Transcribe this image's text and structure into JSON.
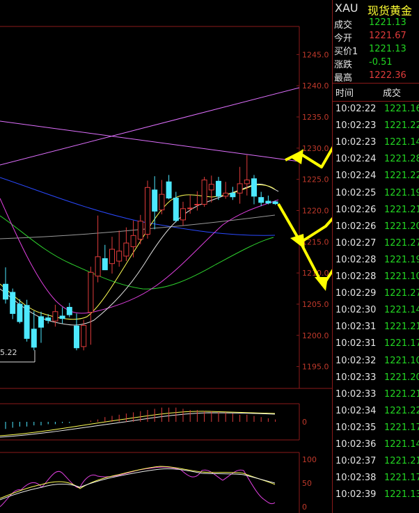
{
  "header": {
    "symbol": "XAU",
    "name": "现货黄金"
  },
  "quote": [
    {
      "label": "成交",
      "value": "1221.13",
      "color": "#22d622"
    },
    {
      "label": "今开",
      "value": "1221.67",
      "color": "#e03b3b"
    },
    {
      "label": "买价1",
      "value": "1221.13",
      "color": "#22d622"
    },
    {
      "label": "涨跌",
      "value": "-0.51",
      "color": "#22d622"
    },
    {
      "label": "最高",
      "value": "1222.36",
      "color": "#e03b3b"
    }
  ],
  "ticks_header": {
    "time": "时间",
    "price": "成交"
  },
  "ticks": [
    {
      "time": "10:02:22",
      "price": "1221.16"
    },
    {
      "time": "10:02:23",
      "price": "1221.22"
    },
    {
      "time": "10:02:23",
      "price": "1221.14"
    },
    {
      "time": "10:02:24",
      "price": "1221.28"
    },
    {
      "time": "10:02:24",
      "price": "1221.22"
    },
    {
      "time": "10:02:25",
      "price": "1221.19"
    },
    {
      "time": "10:02:26",
      "price": "1221.21"
    },
    {
      "time": "10:02:26",
      "price": "1221.20"
    },
    {
      "time": "10:02:27",
      "price": "1221.27"
    },
    {
      "time": "10:02:28",
      "price": "1221.19"
    },
    {
      "time": "10:02:28",
      "price": "1221.10"
    },
    {
      "time": "10:02:29",
      "price": "1221.27"
    },
    {
      "time": "10:02:30",
      "price": "1221.14"
    },
    {
      "time": "10:02:31",
      "price": "1221.21"
    },
    {
      "time": "10:02:31",
      "price": "1221.17"
    },
    {
      "time": "10:02:32",
      "price": "1221.10"
    },
    {
      "time": "10:02:33",
      "price": "1221.20"
    },
    {
      "time": "10:02:33",
      "price": "1221.21"
    },
    {
      "time": "10:02:34",
      "price": "1221.22"
    },
    {
      "time": "10:02:35",
      "price": "1221.17"
    },
    {
      "time": "10:02:36",
      "price": "1221.14"
    },
    {
      "time": "10:02:37",
      "price": "1221.21"
    },
    {
      "time": "10:02:38",
      "price": "1221.17"
    },
    {
      "time": "10:02:39",
      "price": "1221.13"
    }
  ],
  "main_axis_labels": [
    "1245.0",
    "1240.0",
    "1235.0",
    "1230.0",
    "1225.0",
    "1220.0",
    "1215.0",
    "1210.0",
    "1205.0",
    "1200.0",
    "1195.0"
  ],
  "low_marker_label": "5.22",
  "macd_axis_label": "0",
  "kdj_axis_labels": [
    "100",
    "50",
    "0"
  ],
  "colors": {
    "up": "#e03b3b",
    "down": "#4de8ff",
    "grid": "#8b1a1a",
    "arrow": "#ffff00"
  },
  "chart_data": {
    "type": "candlestick",
    "y_axis_ticks": [
      1245,
      1240,
      1235,
      1230,
      1225,
      1220,
      1215,
      1210,
      1205,
      1200,
      1195
    ],
    "ylim": [
      1191.5,
      1249.5
    ],
    "candles": [
      {
        "o": 1208.2,
        "h": 1210.9,
        "l": 1205.1,
        "c": 1205.8
      },
      {
        "o": 1206.9,
        "h": 1207.5,
        "l": 1202.6,
        "c": 1203.5
      },
      {
        "o": 1205.0,
        "h": 1205.8,
        "l": 1201.9,
        "c": 1202.2
      },
      {
        "o": 1204.8,
        "h": 1205.7,
        "l": 1199.0,
        "c": 1199.5
      },
      {
        "o": 1201.0,
        "h": 1203.9,
        "l": 1197.6,
        "c": 1198.1
      },
      {
        "o": 1203.0,
        "h": 1203.8,
        "l": 1198.8,
        "c": 1201.3
      },
      {
        "o": 1202.8,
        "h": 1203.4,
        "l": 1201.9,
        "c": 1202.4
      },
      {
        "o": 1202.3,
        "h": 1204.9,
        "l": 1201.4,
        "c": 1203.8
      },
      {
        "o": 1203.1,
        "h": 1204.5,
        "l": 1201.9,
        "c": 1202.7
      },
      {
        "o": 1204.5,
        "h": 1205.2,
        "l": 1202.9,
        "c": 1203.3
      },
      {
        "o": 1201.5,
        "h": 1203.5,
        "l": 1197.6,
        "c": 1198.0
      },
      {
        "o": 1198.2,
        "h": 1202.5,
        "l": 1197.6,
        "c": 1201.6
      },
      {
        "o": 1203.7,
        "h": 1211.0,
        "l": 1198.5,
        "c": 1210.1
      },
      {
        "o": 1209.5,
        "h": 1219.2,
        "l": 1208.5,
        "c": 1212.6
      },
      {
        "o": 1212.3,
        "h": 1214.5,
        "l": 1210.8,
        "c": 1210.5
      },
      {
        "o": 1211.5,
        "h": 1215.8,
        "l": 1209.9,
        "c": 1213.8
      },
      {
        "o": 1211.9,
        "h": 1216.8,
        "l": 1211.0,
        "c": 1213.5
      },
      {
        "o": 1212.7,
        "h": 1217.3,
        "l": 1211.9,
        "c": 1214.8
      },
      {
        "o": 1214.2,
        "h": 1218.4,
        "l": 1212.5,
        "c": 1216.0
      },
      {
        "o": 1215.4,
        "h": 1219.3,
        "l": 1214.6,
        "c": 1218.3
      },
      {
        "o": 1216.2,
        "h": 1224.8,
        "l": 1215.5,
        "c": 1223.7
      },
      {
        "o": 1223.3,
        "h": 1225.5,
        "l": 1217.0,
        "c": 1219.9
      },
      {
        "o": 1220.1,
        "h": 1224.9,
        "l": 1219.4,
        "c": 1222.6
      },
      {
        "o": 1224.6,
        "h": 1225.7,
        "l": 1221.8,
        "c": 1222.0
      },
      {
        "o": 1222.0,
        "h": 1223.0,
        "l": 1218.1,
        "c": 1218.4
      },
      {
        "o": 1218.5,
        "h": 1221.4,
        "l": 1217.6,
        "c": 1220.3
      },
      {
        "o": 1220.3,
        "h": 1222.5,
        "l": 1219.5,
        "c": 1220.4
      },
      {
        "o": 1220.9,
        "h": 1223.1,
        "l": 1220.0,
        "c": 1221.0
      },
      {
        "o": 1221.0,
        "h": 1225.4,
        "l": 1220.6,
        "c": 1224.9
      },
      {
        "o": 1223.3,
        "h": 1225.6,
        "l": 1221.3,
        "c": 1224.2
      },
      {
        "o": 1224.7,
        "h": 1225.4,
        "l": 1221.7,
        "c": 1222.3
      },
      {
        "o": 1222.3,
        "h": 1224.6,
        "l": 1221.9,
        "c": 1222.8
      },
      {
        "o": 1222.8,
        "h": 1223.8,
        "l": 1221.7,
        "c": 1222.2
      },
      {
        "o": 1222.8,
        "h": 1227.0,
        "l": 1221.1,
        "c": 1224.3
      },
      {
        "o": 1224.3,
        "h": 1228.9,
        "l": 1222.4,
        "c": 1224.9
      },
      {
        "o": 1225.1,
        "h": 1225.7,
        "l": 1221.0,
        "c": 1222.3
      },
      {
        "o": 1222.1,
        "h": 1223.0,
        "l": 1220.7,
        "c": 1221.3
      },
      {
        "o": 1221.5,
        "h": 1222.4,
        "l": 1221.0,
        "c": 1221.2
      },
      {
        "o": 1221.4,
        "h": 1221.6,
        "l": 1220.9,
        "c": 1221.1
      }
    ]
  }
}
